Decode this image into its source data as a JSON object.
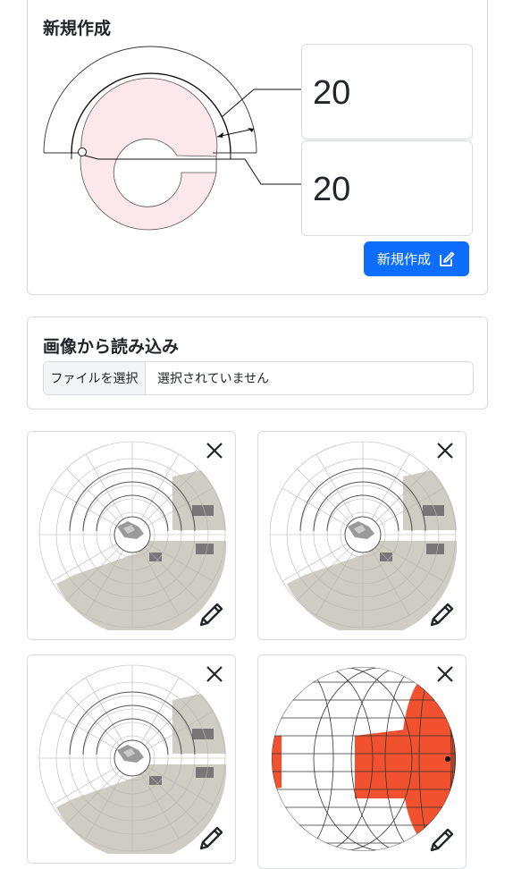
{
  "new_card": {
    "title": "新規作成",
    "value_a": "20",
    "value_b": "20",
    "create_label": "新規作成"
  },
  "load_card": {
    "title": "画像から読み込み",
    "file_button_label": "ファイルを選択",
    "file_status": "選択されていません"
  },
  "colors": {
    "accent": "#0d6efd",
    "ring_fill": "#fce8ea",
    "defect_gray": "#cfcdc3",
    "defect_dark": "#7a7577",
    "sphere_red": "#f2512f"
  },
  "icons": {
    "create": "pencil-square-icon",
    "close": "close-icon",
    "edit": "pencil-icon"
  },
  "thumbnails": [
    {
      "type": "chart",
      "close_icon": "close-icon",
      "edit_icon": "pencil-icon"
    },
    {
      "type": "chart",
      "close_icon": "close-icon",
      "edit_icon": "pencil-icon"
    },
    {
      "type": "chart",
      "close_icon": "close-icon",
      "edit_icon": "pencil-icon"
    },
    {
      "type": "sphere",
      "close_icon": "close-icon",
      "edit_icon": "pencil-icon"
    }
  ]
}
